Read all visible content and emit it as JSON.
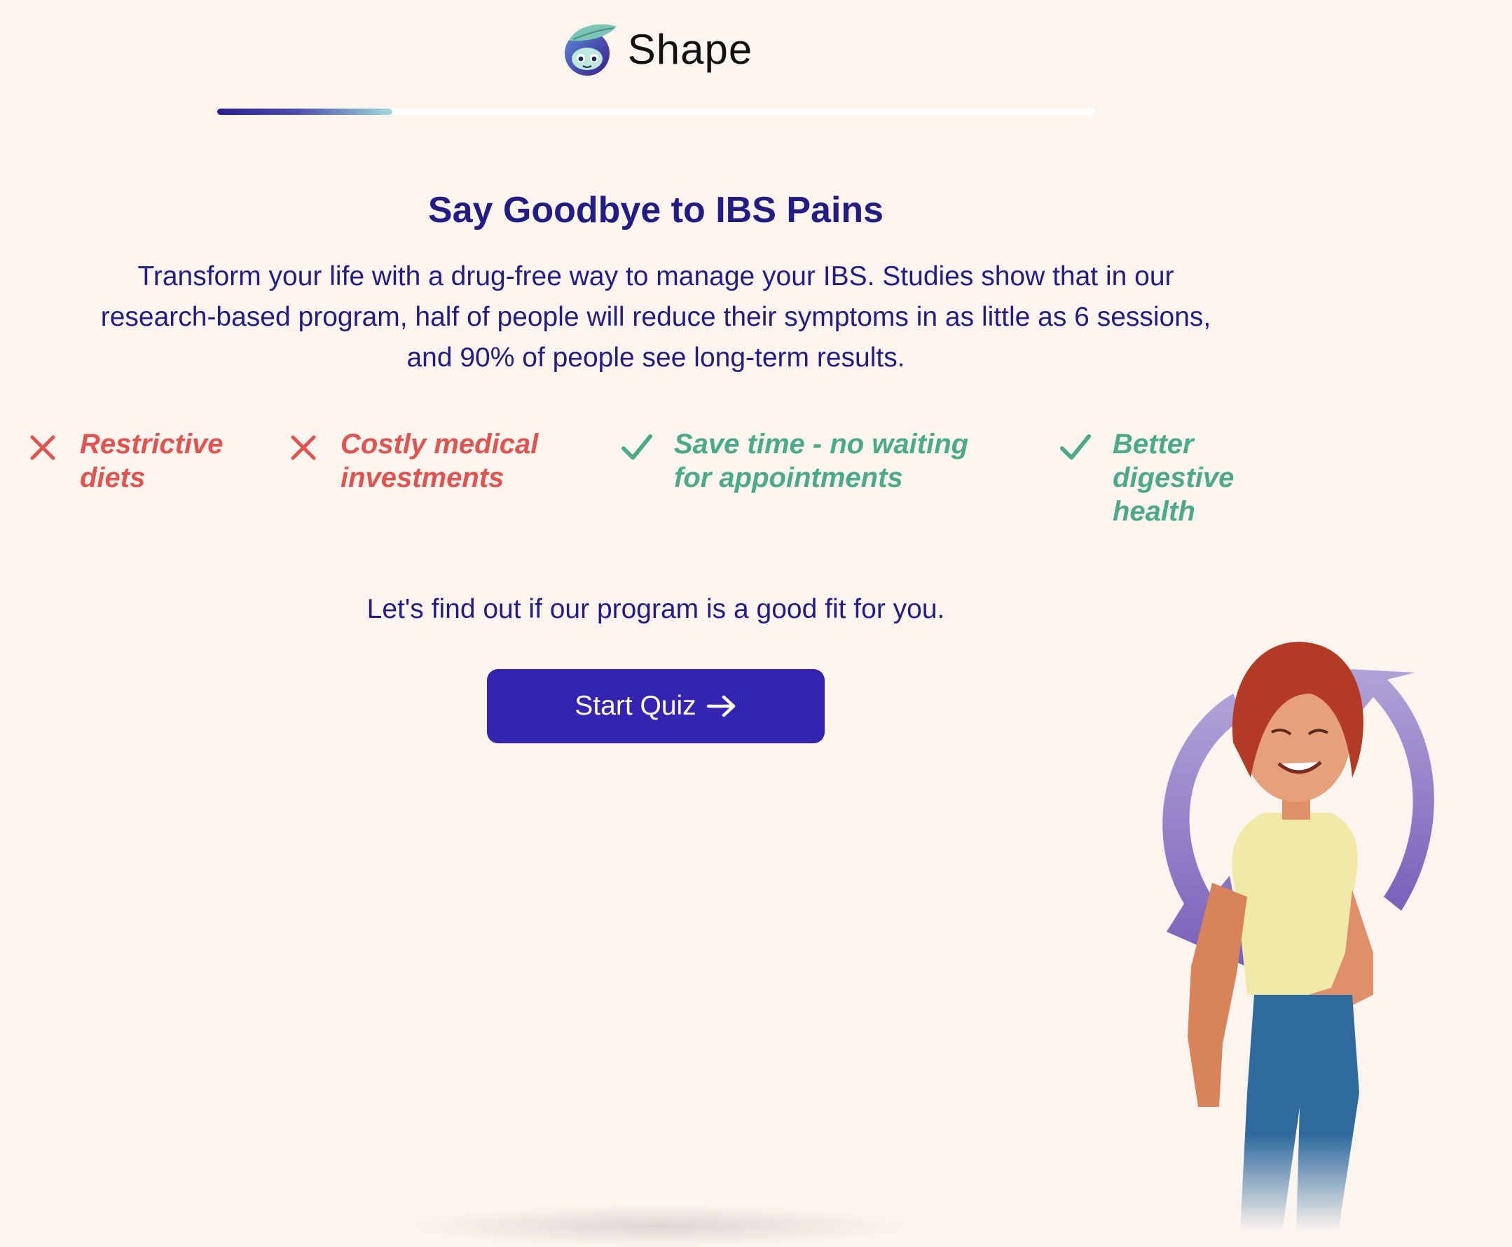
{
  "header": {
    "brand": "Shape",
    "logo_icon": "leaf-face-logo-icon"
  },
  "progress": {
    "fraction": 0.2
  },
  "hero": {
    "title": "Say Goodbye to IBS Pains",
    "intro": "Transform your life with a drug-free way to manage your IBS. Studies show that in our research-based program, half of people will reduce their symptoms in as little as 6 sessions, and 90% of people see long-term results."
  },
  "features": [
    {
      "label": "Restrictive diets",
      "icon": "x-icon",
      "positive": false
    },
    {
      "label": "Costly medical investments",
      "icon": "x-icon",
      "positive": false
    },
    {
      "label": "Save time - no waiting for appointments",
      "icon": "check-icon",
      "positive": true
    },
    {
      "label": "Better digestive health",
      "icon": "check-icon",
      "positive": true
    }
  ],
  "prompt": "Let's find out if our program is a good fit for you.",
  "cta": {
    "label": "Start Quiz",
    "icon": "arrow-right-icon"
  },
  "colors": {
    "background": "#fcf4ef",
    "primary": "#221c86",
    "button": "#3324b1",
    "negative": "#e1534f",
    "positive": "#4aab85"
  }
}
